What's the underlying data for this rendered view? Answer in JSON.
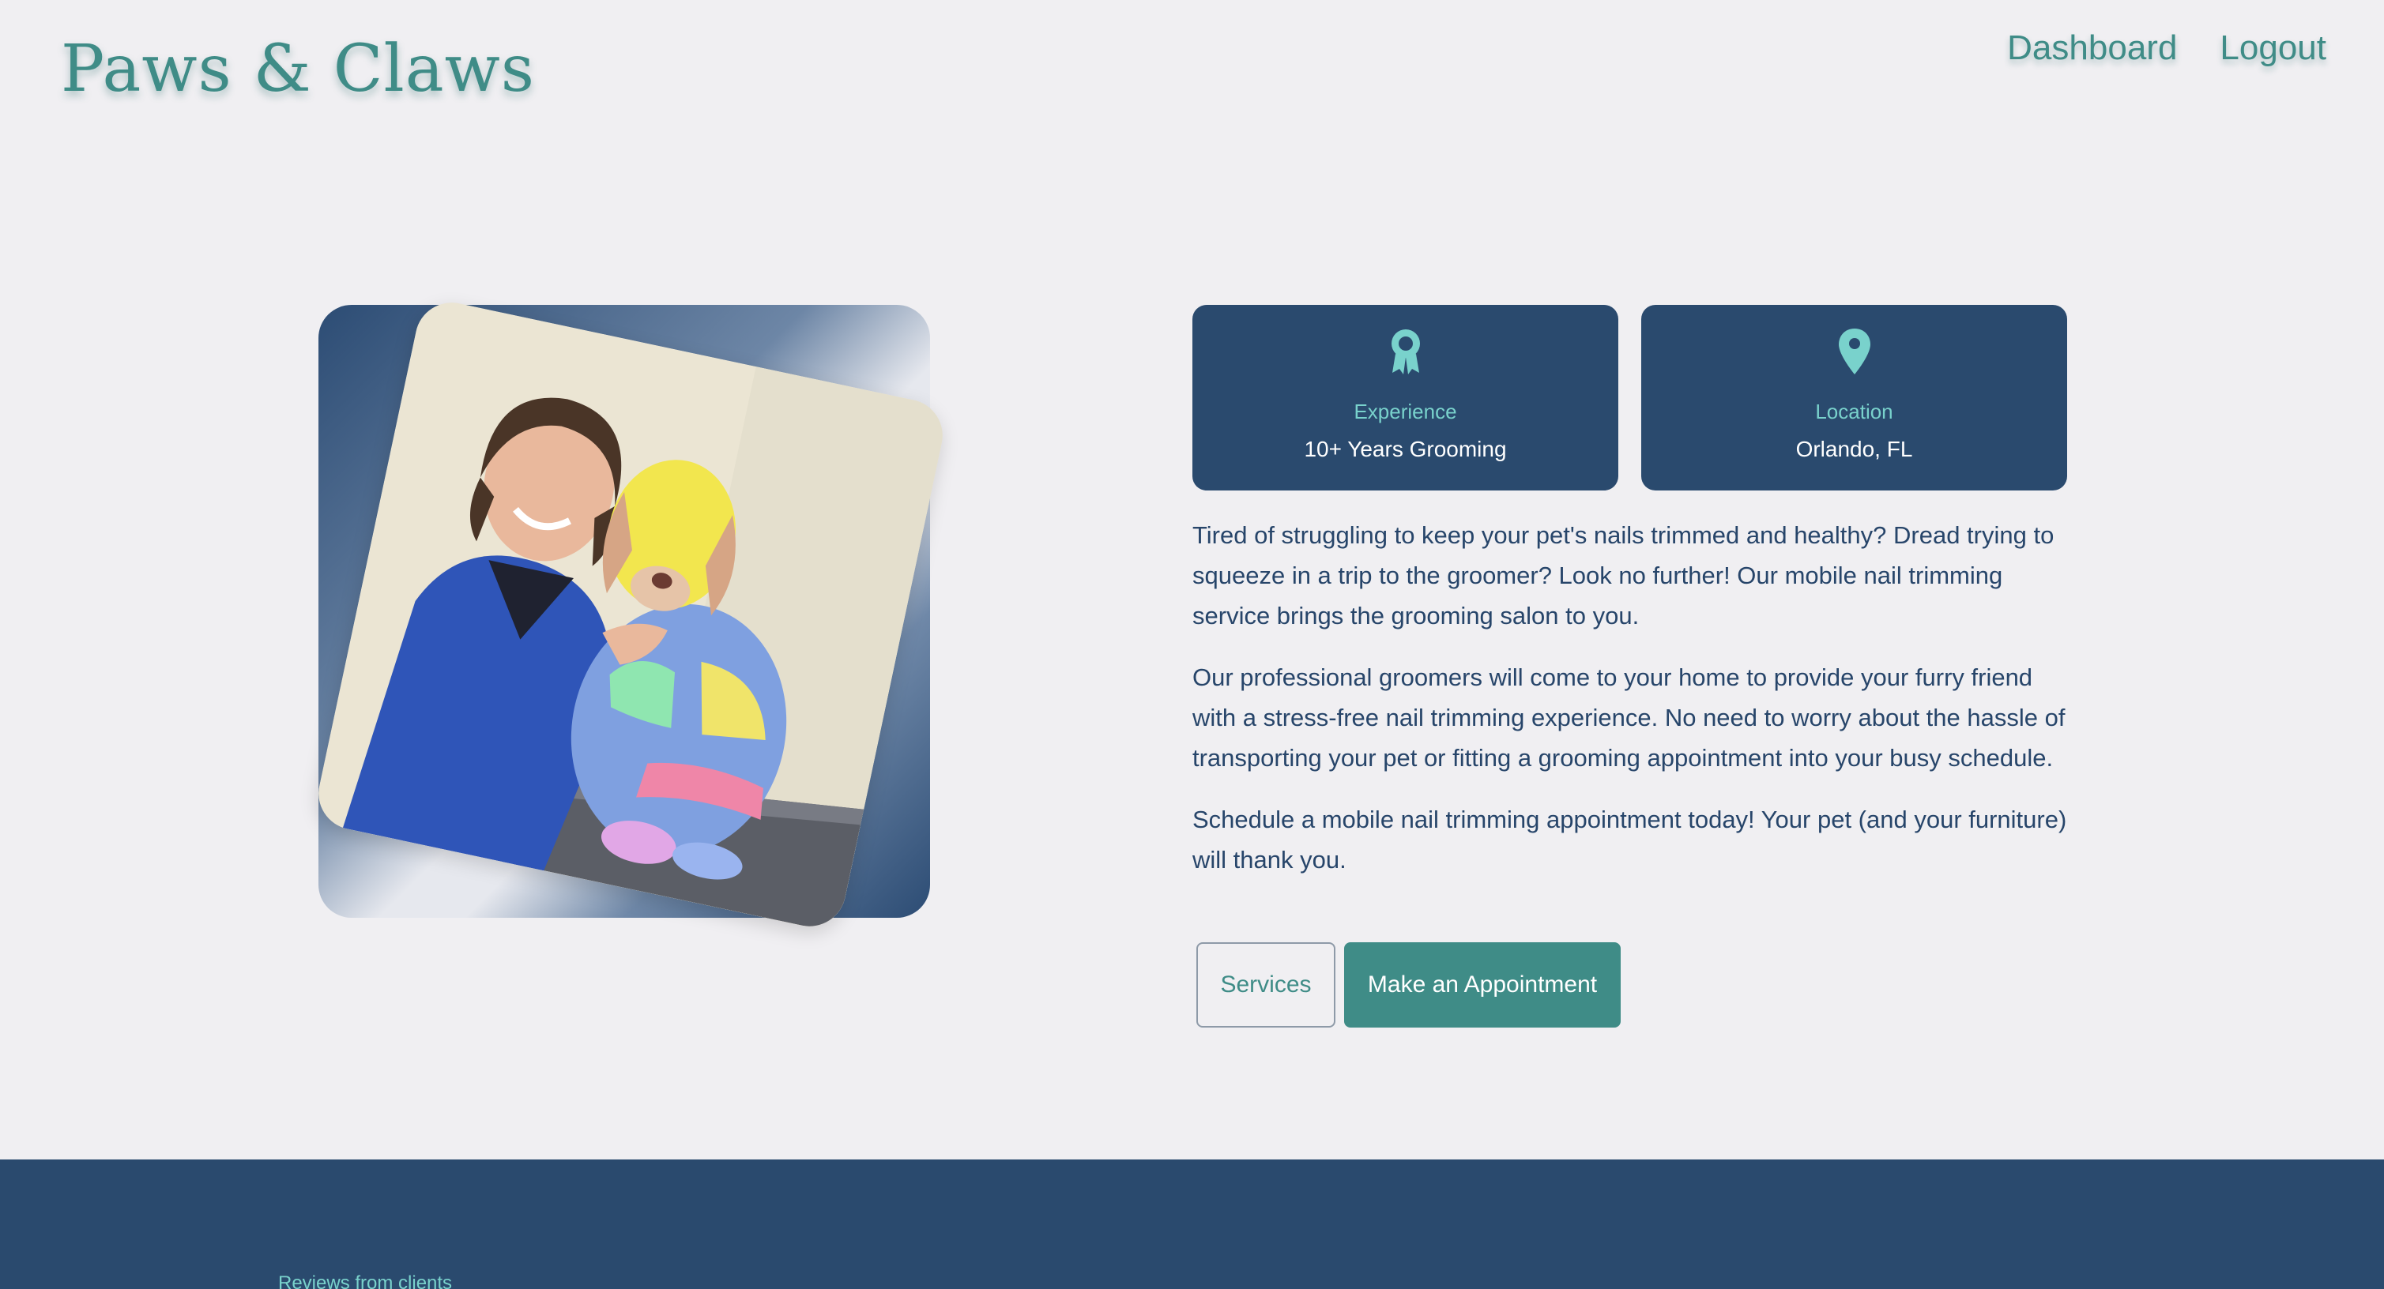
{
  "brand": {
    "name": "Paws & Claws",
    "color": "#3f8c87"
  },
  "nav": {
    "items": [
      {
        "label": "Dashboard"
      },
      {
        "label": "Logout"
      }
    ]
  },
  "hero": {
    "image": {
      "icon": "groomer-with-rainbow-dog-photo"
    },
    "info_cards": [
      {
        "icon": "award-ribbon-icon",
        "label": "Experience",
        "value": "10+ Years Grooming"
      },
      {
        "icon": "map-pin-icon",
        "label": "Location",
        "value": "Orlando, FL"
      }
    ],
    "paragraphs": [
      "Tired of struggling to keep your pet's nails trimmed and healthy? Dread trying to squeeze in a trip to the groomer? Look no further! Our mobile nail trimming service brings the grooming salon to you.",
      "Our professional groomers will come to your home to provide your furry friend with a stress-free nail trimming experience. No need to worry about the hassle of transporting your pet or fitting a grooming appointment into your busy schedule.",
      "Schedule a mobile nail trimming appointment today! Your pet (and your furniture) will thank you."
    ],
    "buttons": {
      "services": "Services",
      "appointment": "Make an Appointment"
    }
  },
  "reviews": {
    "eyebrow": "Reviews from clients"
  },
  "colors": {
    "background": "#f0eff2",
    "navy": "#2a4a6e",
    "teal": "#3f8c87",
    "aqua": "#79d2cc"
  }
}
